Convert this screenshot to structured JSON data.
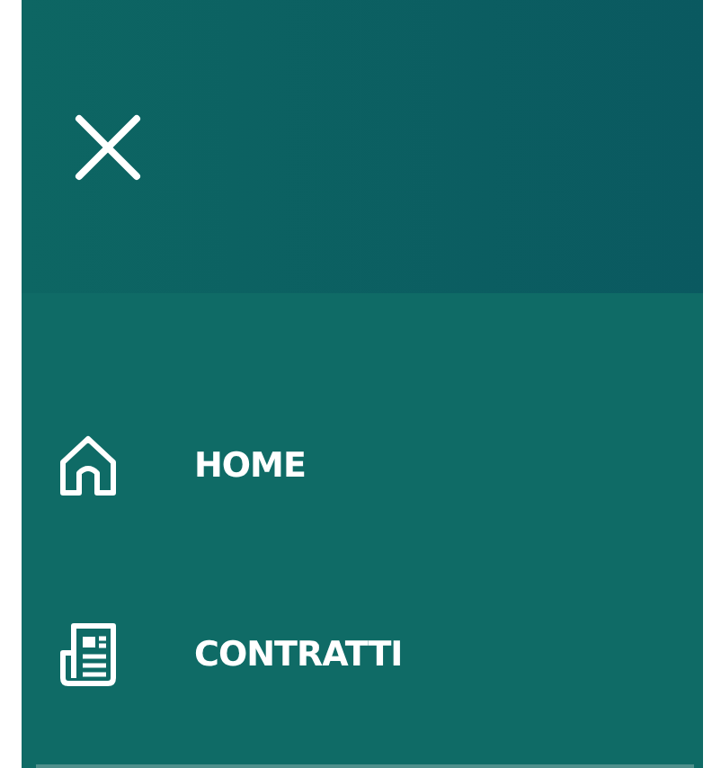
{
  "menu_items": [
    {
      "label": "HOME",
      "kind": "home"
    },
    {
      "label": "CONTRATTI",
      "kind": "contracts"
    }
  ]
}
